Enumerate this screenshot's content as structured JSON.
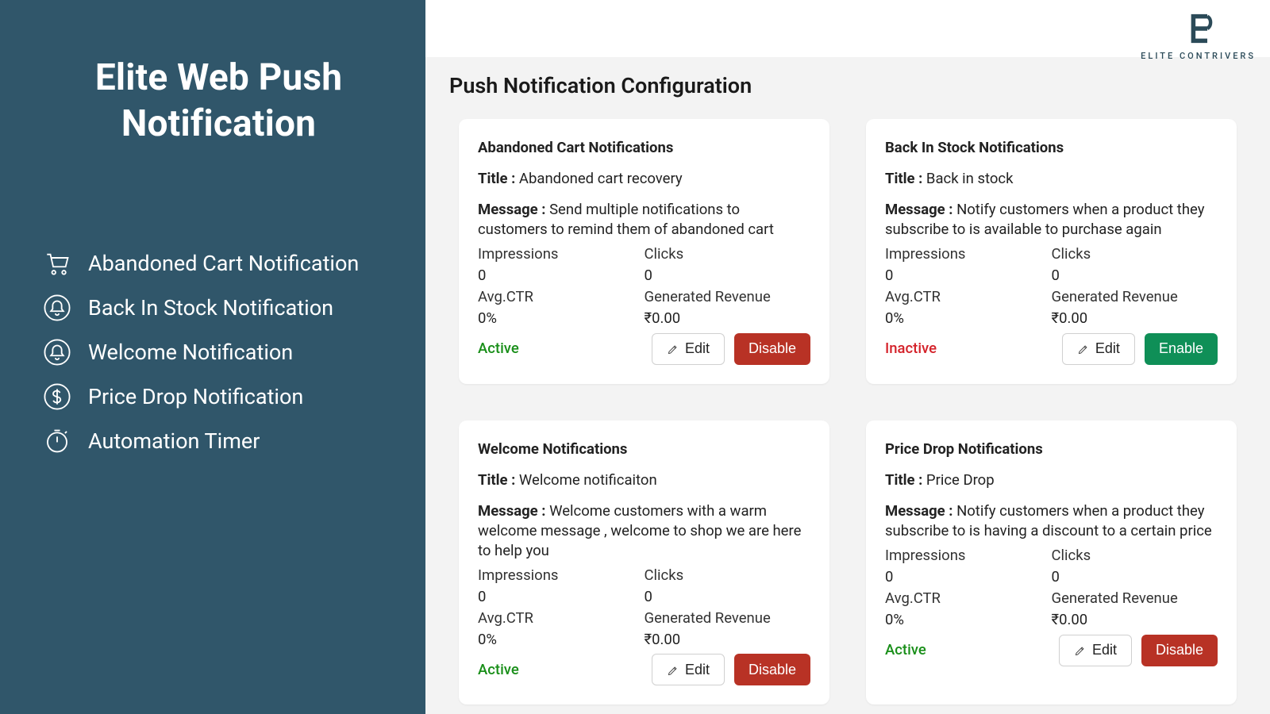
{
  "sidebar": {
    "title": "Elite Web Push Notification",
    "items": [
      {
        "label": "Abandoned Cart Notification"
      },
      {
        "label": "Back In Stock Notification"
      },
      {
        "label": "Welcome Notification"
      },
      {
        "label": "Price Drop Notification"
      },
      {
        "label": "Automation Timer"
      }
    ]
  },
  "brand": {
    "name": "ELITE CONTRIVERS"
  },
  "page": {
    "title": "Push Notification Configuration"
  },
  "labels": {
    "title": "Title : ",
    "message": "Message : ",
    "impressions": "Impressions",
    "clicks": "Clicks",
    "avgctr": "Avg.CTR",
    "revenue": "Generated Revenue",
    "edit": "Edit",
    "disable": "Disable",
    "enable": "Enable",
    "active": "Active",
    "inactive": "Inactive"
  },
  "cards": [
    {
      "heading": "Abandoned Cart Notifications",
      "title": "Abandoned cart recovery",
      "message": "Send multiple notifications to customers to remind them of abandoned cart",
      "impressions": "0",
      "clicks": "0",
      "avgctr": "0%",
      "revenue": "₹0.00",
      "status": "active",
      "primary": "disable"
    },
    {
      "heading": "Back In Stock Notifications",
      "title": "Back in stock",
      "message": "Notify customers when a product they subscribe to is available to purchase again",
      "impressions": "0",
      "clicks": "0",
      "avgctr": "0%",
      "revenue": "₹0.00",
      "status": "inactive",
      "primary": "enable"
    },
    {
      "heading": "Welcome Notifications",
      "title": "Welcome notificaiton",
      "message": "Welcome customers with a warm welcome message , welcome to shop we are here to help you",
      "impressions": "0",
      "clicks": "0",
      "avgctr": "0%",
      "revenue": "₹0.00",
      "status": "active",
      "primary": "disable"
    },
    {
      "heading": "Price Drop Notifications",
      "title": "Price Drop",
      "message": "Notify customers when a product they subscribe to is having a discount to a certain price",
      "impressions": "0",
      "clicks": "0",
      "avgctr": "0%",
      "revenue": "₹0.00",
      "status": "active",
      "primary": "disable"
    }
  ]
}
